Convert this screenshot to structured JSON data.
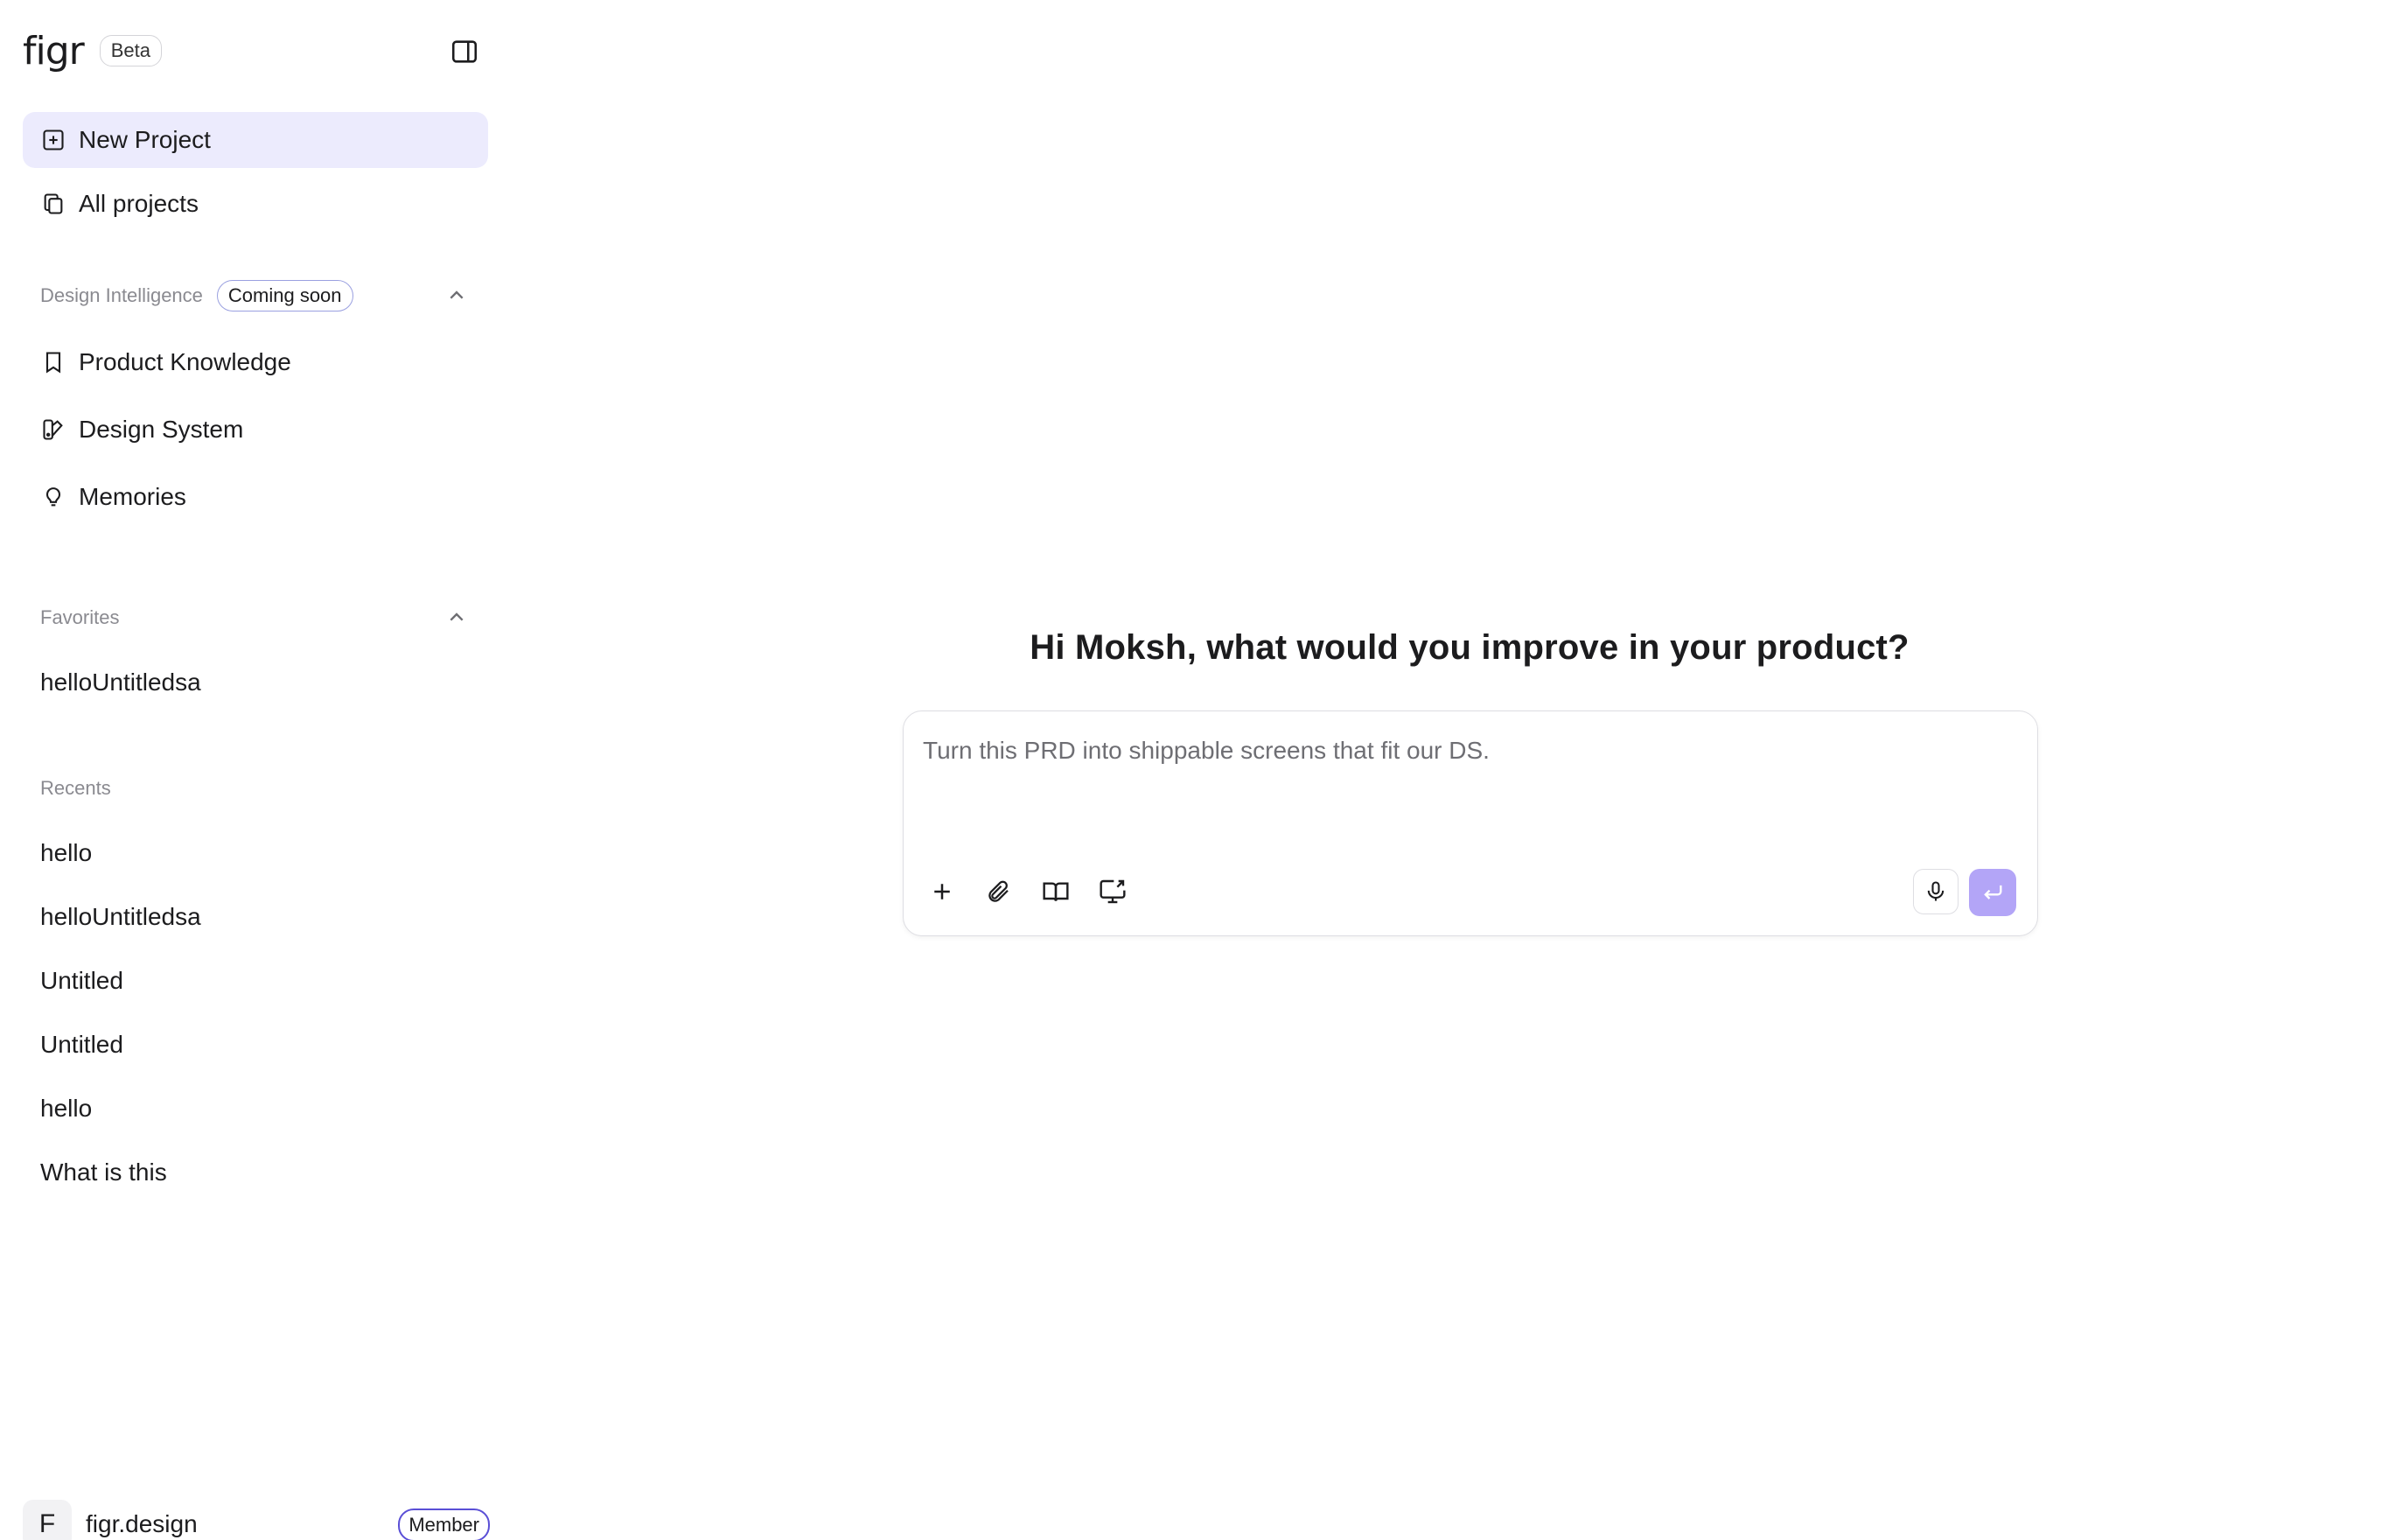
{
  "brand": {
    "logo": "figr",
    "badge": "Beta"
  },
  "sidebar": {
    "new_project": "New Project",
    "all_projects": "All projects",
    "design_intelligence": {
      "title": "Design Intelligence",
      "badge": "Coming soon",
      "items": [
        "Product Knowledge",
        "Design System",
        "Memories"
      ]
    },
    "favorites": {
      "title": "Favorites",
      "items": [
        "helloUntitledsa"
      ]
    },
    "recents": {
      "title": "Recents",
      "items": [
        "hello",
        "helloUntitledsa",
        "Untitled",
        "Untitled",
        "hello",
        "What is this"
      ]
    },
    "footer": {
      "avatar_initial": "F",
      "org": "figr.design",
      "role": "Member"
    }
  },
  "main": {
    "greeting": "Hi Moksh, what would you improve in your product?",
    "composer": {
      "placeholder": "Turn this PRD into shippable screens that fit our DS.",
      "value": ""
    }
  },
  "icons": {
    "panel_toggle": "sidebar-toggle-icon",
    "new_project": "plus-square-icon",
    "all_projects": "copy-icon",
    "product_knowledge": "bookmark-icon",
    "design_system": "palette-icon",
    "memories": "lightbulb-icon",
    "collapse": "chevron-up-icon",
    "add": "plus-icon",
    "attach": "paperclip-icon",
    "book": "book-open-icon",
    "screen": "screen-share-icon",
    "mic": "mic-icon",
    "send": "enter-icon"
  },
  "colors": {
    "accent": "#b3a5f7",
    "active_bg": "#ecebfd",
    "badge_border": "#5a4fd6"
  }
}
